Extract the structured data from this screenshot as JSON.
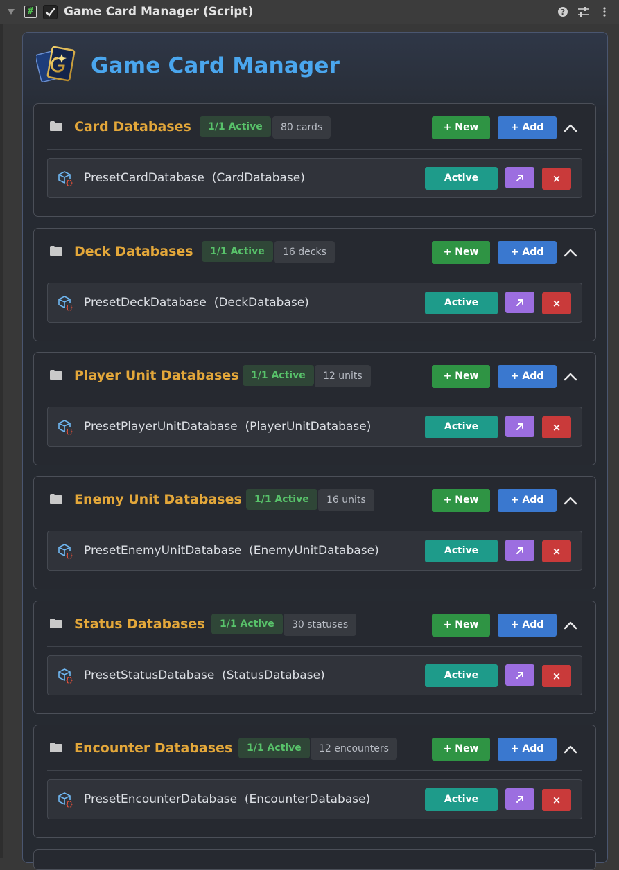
{
  "header": {
    "title": "Game Card Manager (Script)",
    "script_icon": "#",
    "icons": [
      "help-icon",
      "preset-icon",
      "more-options-icon"
    ]
  },
  "main": {
    "title": "Game Card Manager",
    "logo": "game-card-logo-icon"
  },
  "colors": {
    "title_blue": "#4aa6ee",
    "section_title": "#e3a73a",
    "active_green": "#58c26a",
    "new_button": "#2f9444",
    "add_button": "#3a78cf",
    "active_button": "#1e9b8a",
    "open_button": "#9c6ee0",
    "remove_button": "#c93a3a"
  },
  "buttons": {
    "new": "+ New",
    "add": "+ Add",
    "active": "Active",
    "remove": "×"
  },
  "sections": [
    {
      "title": "Card Databases",
      "active": "1/1 Active",
      "count": "80 cards",
      "item": {
        "name": "PresetCardDatabase",
        "type": "(CardDatabase)"
      }
    },
    {
      "title": "Deck Databases",
      "active": "1/1 Active",
      "count": "16 decks",
      "item": {
        "name": "PresetDeckDatabase",
        "type": "(DeckDatabase)"
      }
    },
    {
      "title": "Player Unit Databases",
      "active": "1/1 Active",
      "count": "12 units",
      "item": {
        "name": "PresetPlayerUnitDatabase",
        "type": "(PlayerUnitDatabase)"
      }
    },
    {
      "title": "Enemy Unit Databases",
      "active": "1/1 Active",
      "count": "16 units",
      "item": {
        "name": "PresetEnemyUnitDatabase",
        "type": "(EnemyUnitDatabase)"
      }
    },
    {
      "title": "Status Databases",
      "active": "1/1 Active",
      "count": "30 statuses",
      "item": {
        "name": "PresetStatusDatabase",
        "type": "(StatusDatabase)"
      }
    },
    {
      "title": "Encounter Databases",
      "active": "1/1 Active",
      "count": "12 encounters",
      "item": {
        "name": "PresetEncounterDatabase",
        "type": "(EncounterDatabase)"
      }
    }
  ]
}
